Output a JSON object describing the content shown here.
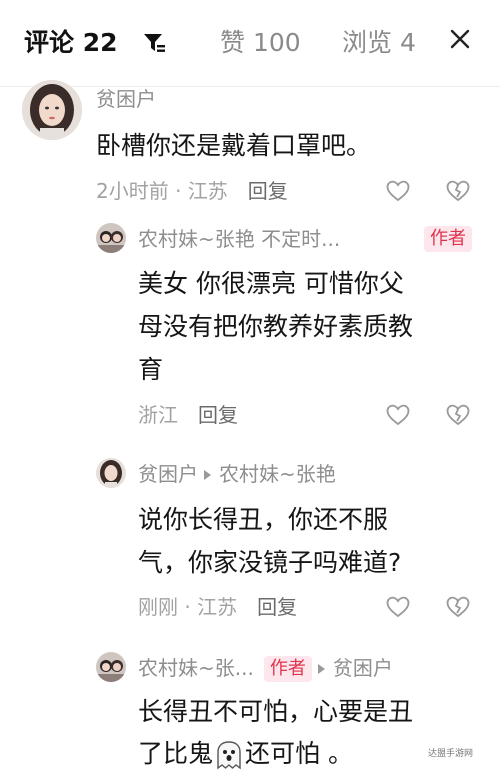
{
  "header": {
    "comments_tab": "评论 22",
    "likes_tab": "赞 100",
    "views_tab": "浏览 4",
    "filter_icon": "filter-icon",
    "close_icon": "close-icon"
  },
  "comments": [
    {
      "user": "贫困户",
      "text": "卧槽你还是戴着口罩吧。",
      "meta": "2小时前 · 江苏",
      "reply": "回复"
    },
    {
      "user": "农村妹~张艳 不定时...",
      "badge": "作者",
      "text_lines": [
        "美女 你很漂亮 可惜你父",
        "母没有把你教养好素质教",
        "育"
      ],
      "meta": "浙江",
      "reply": "回复"
    },
    {
      "user": "贫困户",
      "reply_to": "农村妹~张艳",
      "text_lines": [
        "说你长得丑，你还不服",
        "气，你家没镜子吗难道?"
      ],
      "meta": "刚刚 · 江苏",
      "reply": "回复"
    },
    {
      "user": "农村妹~张...",
      "badge": "作者",
      "reply_to": "贫困户",
      "text_lines": [
        "长得丑不可怕，心要是丑",
        "了比鬼"
      ],
      "text_after_emoji": "还可怕 。",
      "emoji": "ghost-emoji"
    }
  ],
  "colors": {
    "badge_bg": "#fde7ec",
    "badge_text": "#e0334f",
    "muted": "#8e8e8e"
  },
  "watermark": "达盟手游网"
}
